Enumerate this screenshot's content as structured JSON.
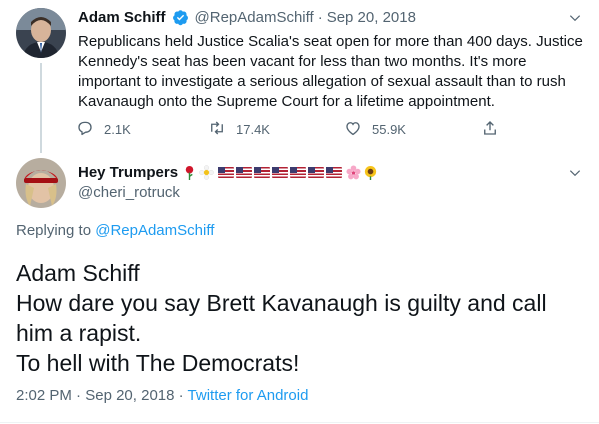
{
  "tweet": {
    "author_name": "Adam Schiff",
    "author_handle": "@RepAdamSchiff",
    "separator": "·",
    "date": "Sep 20, 2018",
    "text": "Republicans held Justice Scalia's seat open for more than 400 days. Justice Kennedy's seat has been vacant for less than two months. It's more important to investigate a serious allegation of sexual assault than to rush Kavanaugh onto the Supreme Court for a lifetime appointment.",
    "replies": "2.1K",
    "retweets": "17.4K",
    "likes": "55.9K"
  },
  "reply": {
    "author_name": "Hey Trumpers",
    "author_handle": "@cheri_rotruck",
    "name_emojis": [
      "rose",
      "daisy",
      "us-flag",
      "us-flag",
      "us-flag",
      "us-flag",
      "us-flag",
      "us-flag",
      "us-flag",
      "cherry-blossom",
      "sunflower"
    ],
    "replying_prefix": "Replying to",
    "replying_handle": "@RepAdamSchiff",
    "lines": [
      "Adam Schiff",
      "How dare you say Brett Kavanaugh is guilty and call him a rapist.",
      "To hell with The Democrats!"
    ],
    "time": "2:02 PM",
    "separator": "·",
    "date": "Sep 20, 2018",
    "source": "Twitter for Android"
  },
  "colors": {
    "verified": "#1d9bf0",
    "link": "#1d9bf0",
    "secondary_text": "#536471"
  },
  "icons": [
    "verified-badge-icon",
    "chevron-down-icon",
    "reply-icon",
    "retweet-icon",
    "like-icon",
    "share-icon"
  ]
}
